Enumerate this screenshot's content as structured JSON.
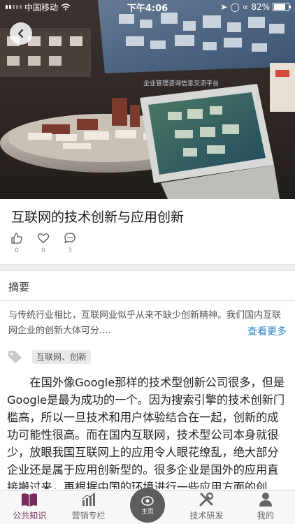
{
  "status_bar": {
    "carrier": "中国移动",
    "time": "下午4:06",
    "battery": "82%",
    "battery_level": 0.82
  },
  "hero": {
    "banner_text": "企业管理咨询信息交流平台"
  },
  "article": {
    "title": "互联网的技术创新与应用创新",
    "likes": "0",
    "favorites": "0",
    "comments": "3"
  },
  "summary": {
    "heading": "摘要",
    "text": "与传统行业相比，互联网业似乎从来不缺少创新精神。我们国内互联网企业的创新大体可分....",
    "more_label": "查看更多"
  },
  "tag": {
    "label": "互联网、创新"
  },
  "body": {
    "paragraph": "在国外像Google那样的技术型创新公司很多，但是Google是最为成功的一个。因为搜索引擎的技术创新门槛高，所以一旦技术和用户体验结合在一起，创新的成功可能性很高。而在国内互联网，技术型公司本身就很少，放眼我国互联网上的应用令人眼花缭乱，绝大部分企业还是属于应用创新型的。很多企业是国外的应用直接搬过来，再根据中国的环境进行一些应用方面的创"
  },
  "tabbar": {
    "items": [
      {
        "label": "公共知识",
        "icon": "book-icon"
      },
      {
        "label": "营销专栏",
        "icon": "bar-chart-icon"
      },
      {
        "label": "主页",
        "icon": "home-eye-icon"
      },
      {
        "label": "技术研发",
        "icon": "tools-icon"
      },
      {
        "label": "我的",
        "icon": "user-icon"
      }
    ],
    "active_color": "#7a2b5e"
  },
  "colors": {
    "link": "#2a83c4"
  }
}
